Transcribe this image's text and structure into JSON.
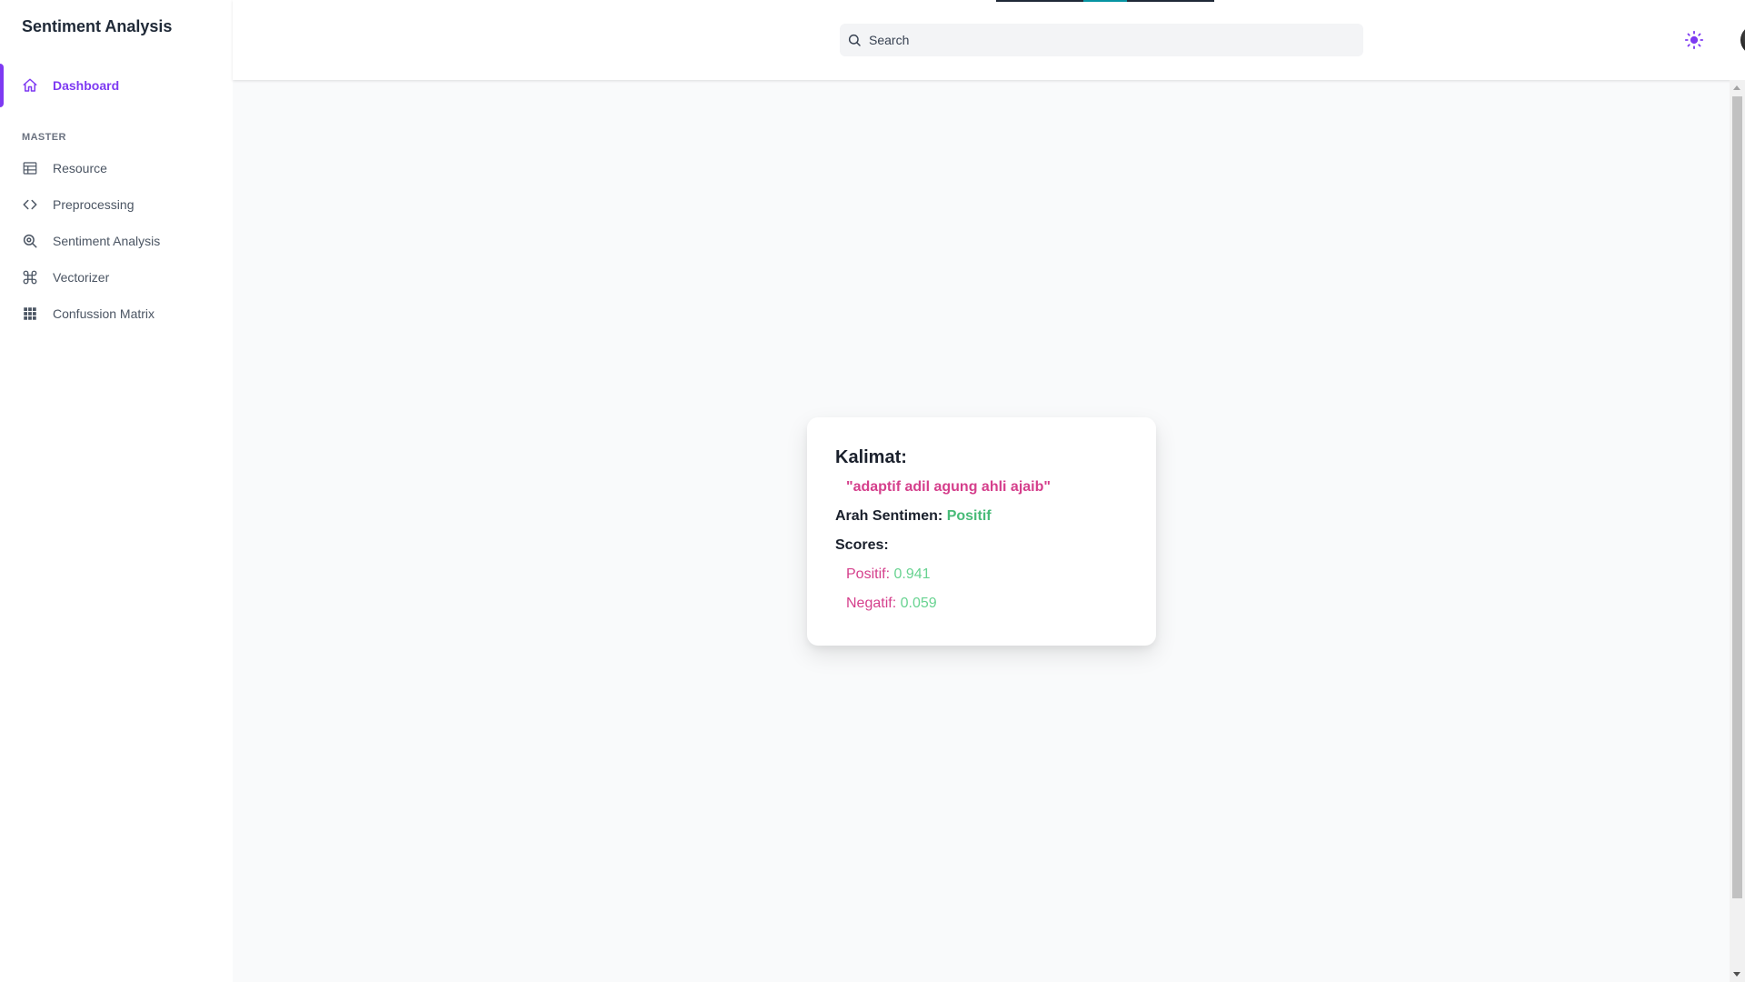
{
  "app": {
    "title": "Sentiment Analysis"
  },
  "sidebar": {
    "dashboard": {
      "label": "Dashboard",
      "icon": "home-icon"
    },
    "section_label": "MASTER",
    "items": [
      {
        "label": "Resource",
        "icon": "table-icon"
      },
      {
        "label": "Preprocessing",
        "icon": "code-icon"
      },
      {
        "label": "Sentiment Analysis",
        "icon": "search-zoom-icon"
      },
      {
        "label": "Vectorizer",
        "icon": "command-icon"
      },
      {
        "label": "Confussion Matrix",
        "icon": "grid-icon"
      }
    ]
  },
  "header": {
    "search": {
      "placeholder": "Search",
      "value": ""
    },
    "theme_toggle_icon": "sun-icon",
    "avatar": "user-avatar"
  },
  "result": {
    "title": "Kalimat:",
    "sentence": "\"adaptif adil agung ahli ajaib\"",
    "direction_label": "Arah Sentimen:",
    "direction_value": "Positif",
    "scores_label": "Scores:",
    "scores": [
      {
        "label": "Positif:",
        "value": "0.941"
      },
      {
        "label": "Negatif:",
        "value": "0.059"
      }
    ]
  },
  "colors": {
    "accent": "#7e3af2",
    "sentence": "#d53f8c",
    "positive": "#48bb78"
  }
}
